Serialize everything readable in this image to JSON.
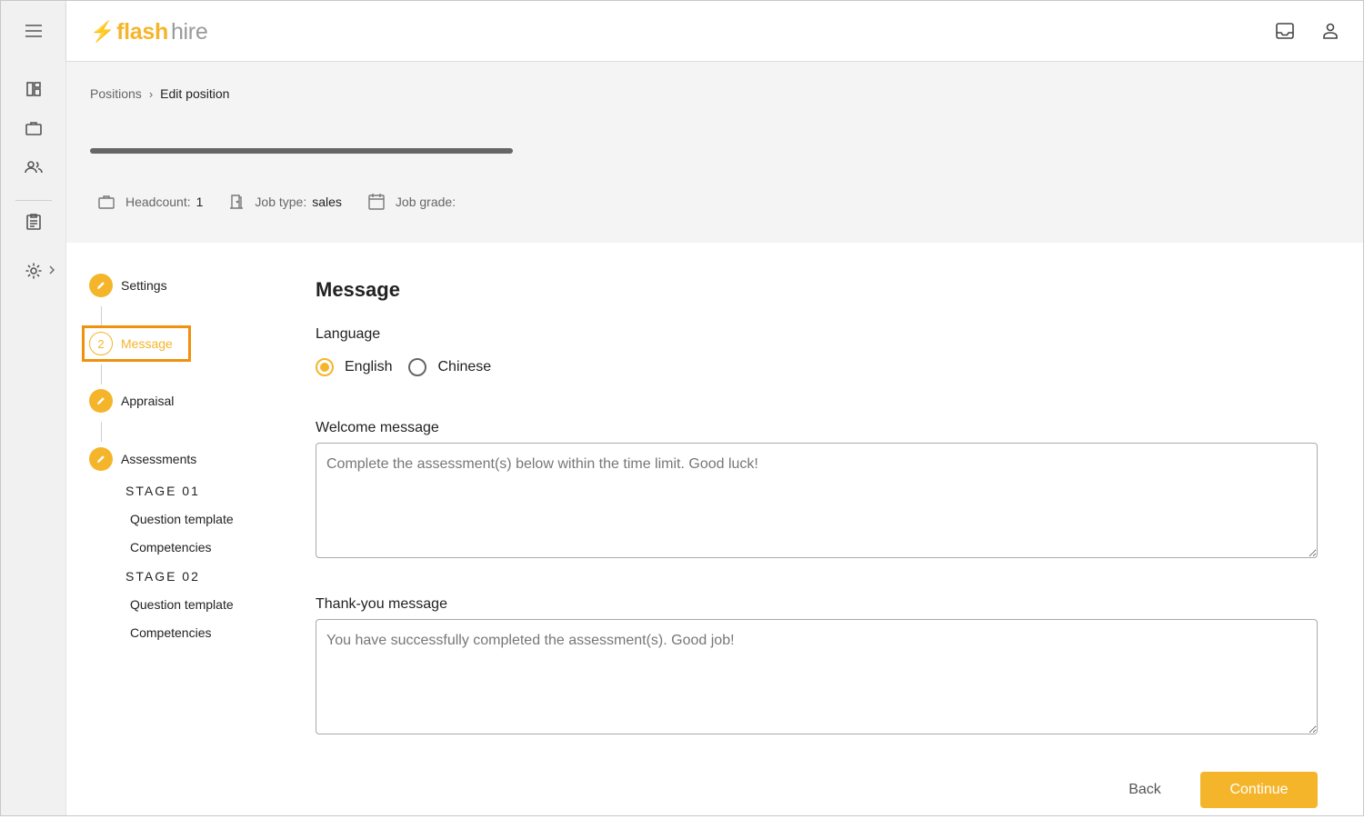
{
  "brand": {
    "bolt": "⚡",
    "flash": "flash",
    "hire": "hire",
    "accent": "#f5b52a"
  },
  "breadcrumb": {
    "parent": "Positions",
    "separator": "›",
    "current": "Edit position"
  },
  "meta": {
    "headcount_label": "Headcount:",
    "headcount_value": "1",
    "jobtype_label": "Job type:",
    "jobtype_value": "sales",
    "jobgrade_label": "Job grade:",
    "jobgrade_value": ""
  },
  "steps": [
    {
      "label": "Settings",
      "status": "done"
    },
    {
      "label": "Message",
      "number": "2",
      "status": "active"
    },
    {
      "label": "Appraisal",
      "status": "done"
    },
    {
      "label": "Assessments",
      "status": "done"
    }
  ],
  "stages": [
    {
      "label": "STAGE 01",
      "items": [
        "Question template",
        "Competencies"
      ]
    },
    {
      "label": "STAGE 02",
      "items": [
        "Question template",
        "Competencies"
      ]
    }
  ],
  "form": {
    "title": "Message",
    "language_label": "Language",
    "languages": [
      {
        "label": "English",
        "selected": true
      },
      {
        "label": "Chinese",
        "selected": false
      }
    ],
    "welcome_label": "Welcome message",
    "welcome_placeholder": "Complete the assessment(s) below within the time limit. Good luck!",
    "thanks_label": "Thank-you message",
    "thanks_placeholder": "You have successfully completed the assessment(s). Good job!"
  },
  "actions": {
    "back": "Back",
    "continue": "Continue"
  },
  "icons": {
    "rail": [
      "menu-icon",
      "dashboard-icon",
      "briefcase-icon",
      "people-icon",
      "clipboard-icon",
      "gear-icon"
    ],
    "header": [
      "inbox-icon",
      "account-icon"
    ]
  }
}
